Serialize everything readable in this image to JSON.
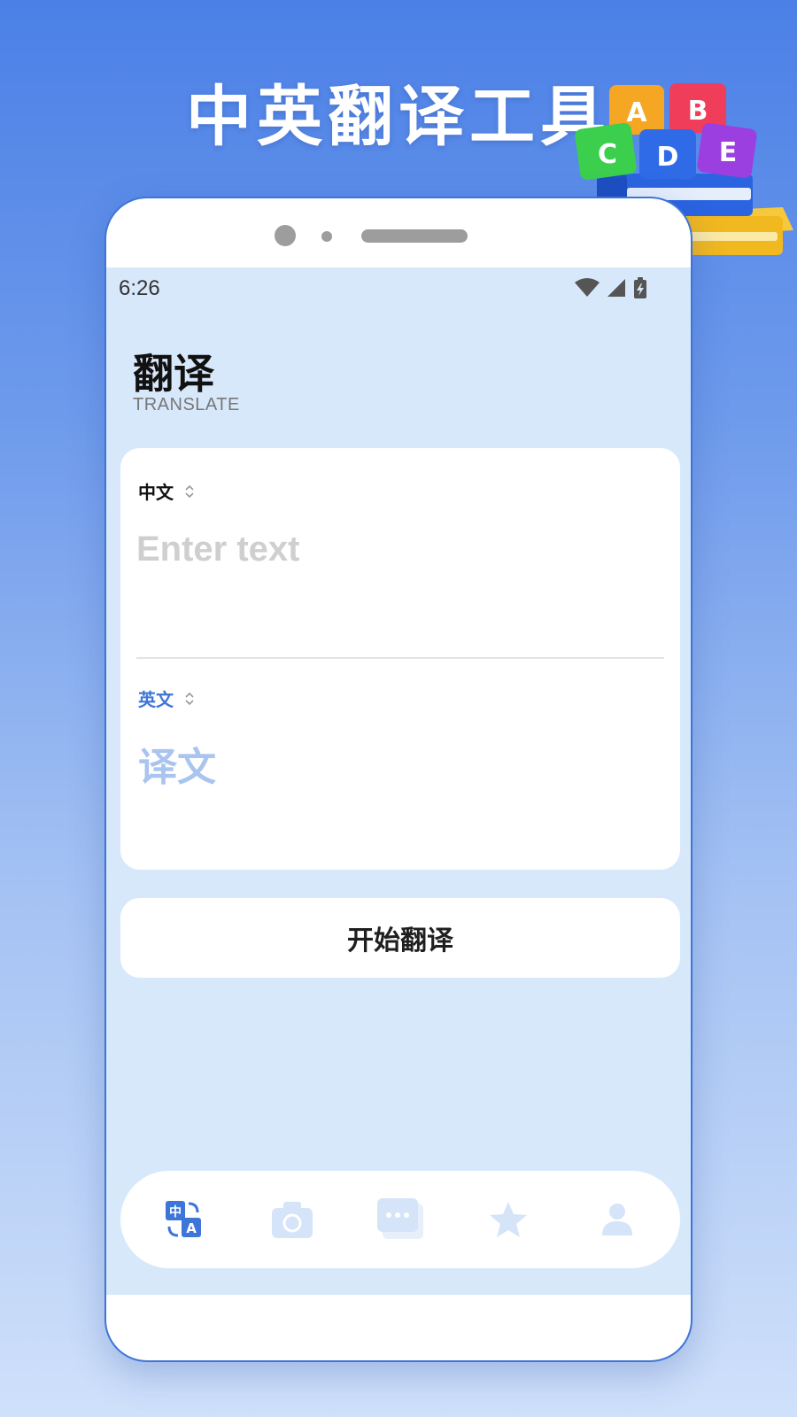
{
  "promo": {
    "title": "中英翻译工具"
  },
  "status_bar": {
    "time": "6:26"
  },
  "header": {
    "title": "翻译",
    "subtitle": "TRANSLATE"
  },
  "source": {
    "language": "中文",
    "placeholder": "Enter text",
    "value": ""
  },
  "target": {
    "language": "英文",
    "placeholder": "译文"
  },
  "action": {
    "translate_label": "开始翻译"
  },
  "decoration": {
    "blocks": [
      "A",
      "B",
      "C",
      "D",
      "E"
    ]
  },
  "bottom_nav": {
    "items": [
      {
        "icon": "translate-icon",
        "active": true
      },
      {
        "icon": "camera-icon",
        "active": false
      },
      {
        "icon": "chat-icon",
        "active": false
      },
      {
        "icon": "star-icon",
        "active": false
      },
      {
        "icon": "user-icon",
        "active": false
      }
    ]
  },
  "colors": {
    "accent": "#3d76d8",
    "background_top": "#4b80e6",
    "screen_bg": "#d8e8fb",
    "nav_inactive": "#d5e4f8"
  }
}
